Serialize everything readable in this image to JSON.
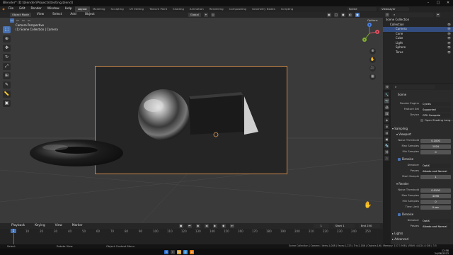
{
  "window": {
    "title": "Blender* [D:\\blender\\Projects\\testing.blend]"
  },
  "menubar": {
    "menus": [
      "File",
      "Edit",
      "Render",
      "Window",
      "Help"
    ],
    "workspaces": [
      "Layout",
      "Modeling",
      "Sculpting",
      "UV Editing",
      "Texture Paint",
      "Shading",
      "Animation",
      "Rendering",
      "Compositing",
      "Geometry Nodes",
      "Scripting"
    ],
    "active_workspace": "Layout",
    "scene": "Scene",
    "view_layer": "ViewLayer"
  },
  "viewport": {
    "mode": "Object Mode",
    "menus": [
      "View",
      "Select",
      "Add",
      "Object"
    ],
    "transform": "Global",
    "options_label": "Options",
    "info_line1": "Camera Perspective",
    "info_line2": "(1) Scene Collection | Camera",
    "gizmo_axes": [
      "X",
      "Y",
      "Z"
    ]
  },
  "outliner": {
    "title": "Scene Collection",
    "items": [
      {
        "name": "Collection",
        "indent": 0
      },
      {
        "name": "Camera",
        "indent": 1,
        "selected": true
      },
      {
        "name": "Cone",
        "indent": 1
      },
      {
        "name": "Cube",
        "indent": 1
      },
      {
        "name": "Light",
        "indent": 1
      },
      {
        "name": "Sphere",
        "indent": 1
      },
      {
        "name": "Torus",
        "indent": 1
      }
    ]
  },
  "properties": {
    "context": "Scene",
    "render_engine_label": "Render Engine",
    "render_engine": "Cycles",
    "feature_set_label": "Feature Set",
    "feature_set": "Supported",
    "device_label": "Device",
    "device": "GPU Compute",
    "osl_label": "Open Shading Lang...",
    "sampling": "Sampling",
    "viewport": "Viewport",
    "noise_threshold_label": "Noise Threshold",
    "vp_noise": "0.1000",
    "max_samples_label": "Max Samples",
    "vp_max": "1024",
    "min_samples_label": "Min Samples",
    "vp_min": "0",
    "denoise": "Denoise",
    "denoiser_label": "Denoiser",
    "vp_denoiser": "OptiX",
    "passes_label": "Passes",
    "vp_passes": "Albedo and Normal",
    "start_sample_label": "Start Sample",
    "vp_start": "1",
    "render": "Render",
    "r_noise": "0.0100",
    "r_max": "4096",
    "r_min": "0",
    "time_limit_label": "Time Limit",
    "r_time": "0 sec",
    "r_denoiser": "OptiX",
    "r_passes": "Albedo and Normal",
    "lights": "Lights",
    "advanced": "Advanced"
  },
  "timeline": {
    "menus": [
      "Playback",
      "Keying",
      "View",
      "Marker"
    ],
    "current_frame": "1",
    "start_label": "Start",
    "start": "1",
    "end_label": "End",
    "end": "250",
    "ticks": [
      "0",
      "10",
      "20",
      "30",
      "40",
      "50",
      "60",
      "70",
      "80",
      "90",
      "100",
      "110",
      "120",
      "130",
      "140",
      "150",
      "160",
      "170",
      "180",
      "190",
      "200",
      "210",
      "220",
      "230",
      "240",
      "250"
    ]
  },
  "statusbar": {
    "left1": "Select",
    "left2": "Rotate View",
    "left3": "Object Context Menu",
    "stats": "Scene Collection | Camera | Verts:1,088 | Faces:1,223 | Tris:2,186 | Objects:1/6 | Memory: 157.1 MiB | VRAM: 4.0/24.0 GiB | 3.5",
    "clock_time": "12:58",
    "clock_date": "24/06/2023"
  },
  "colors": {
    "accent": "#4772b3",
    "camera_frame": "#c9894a",
    "viewport_bg": "#3a3a3a"
  }
}
